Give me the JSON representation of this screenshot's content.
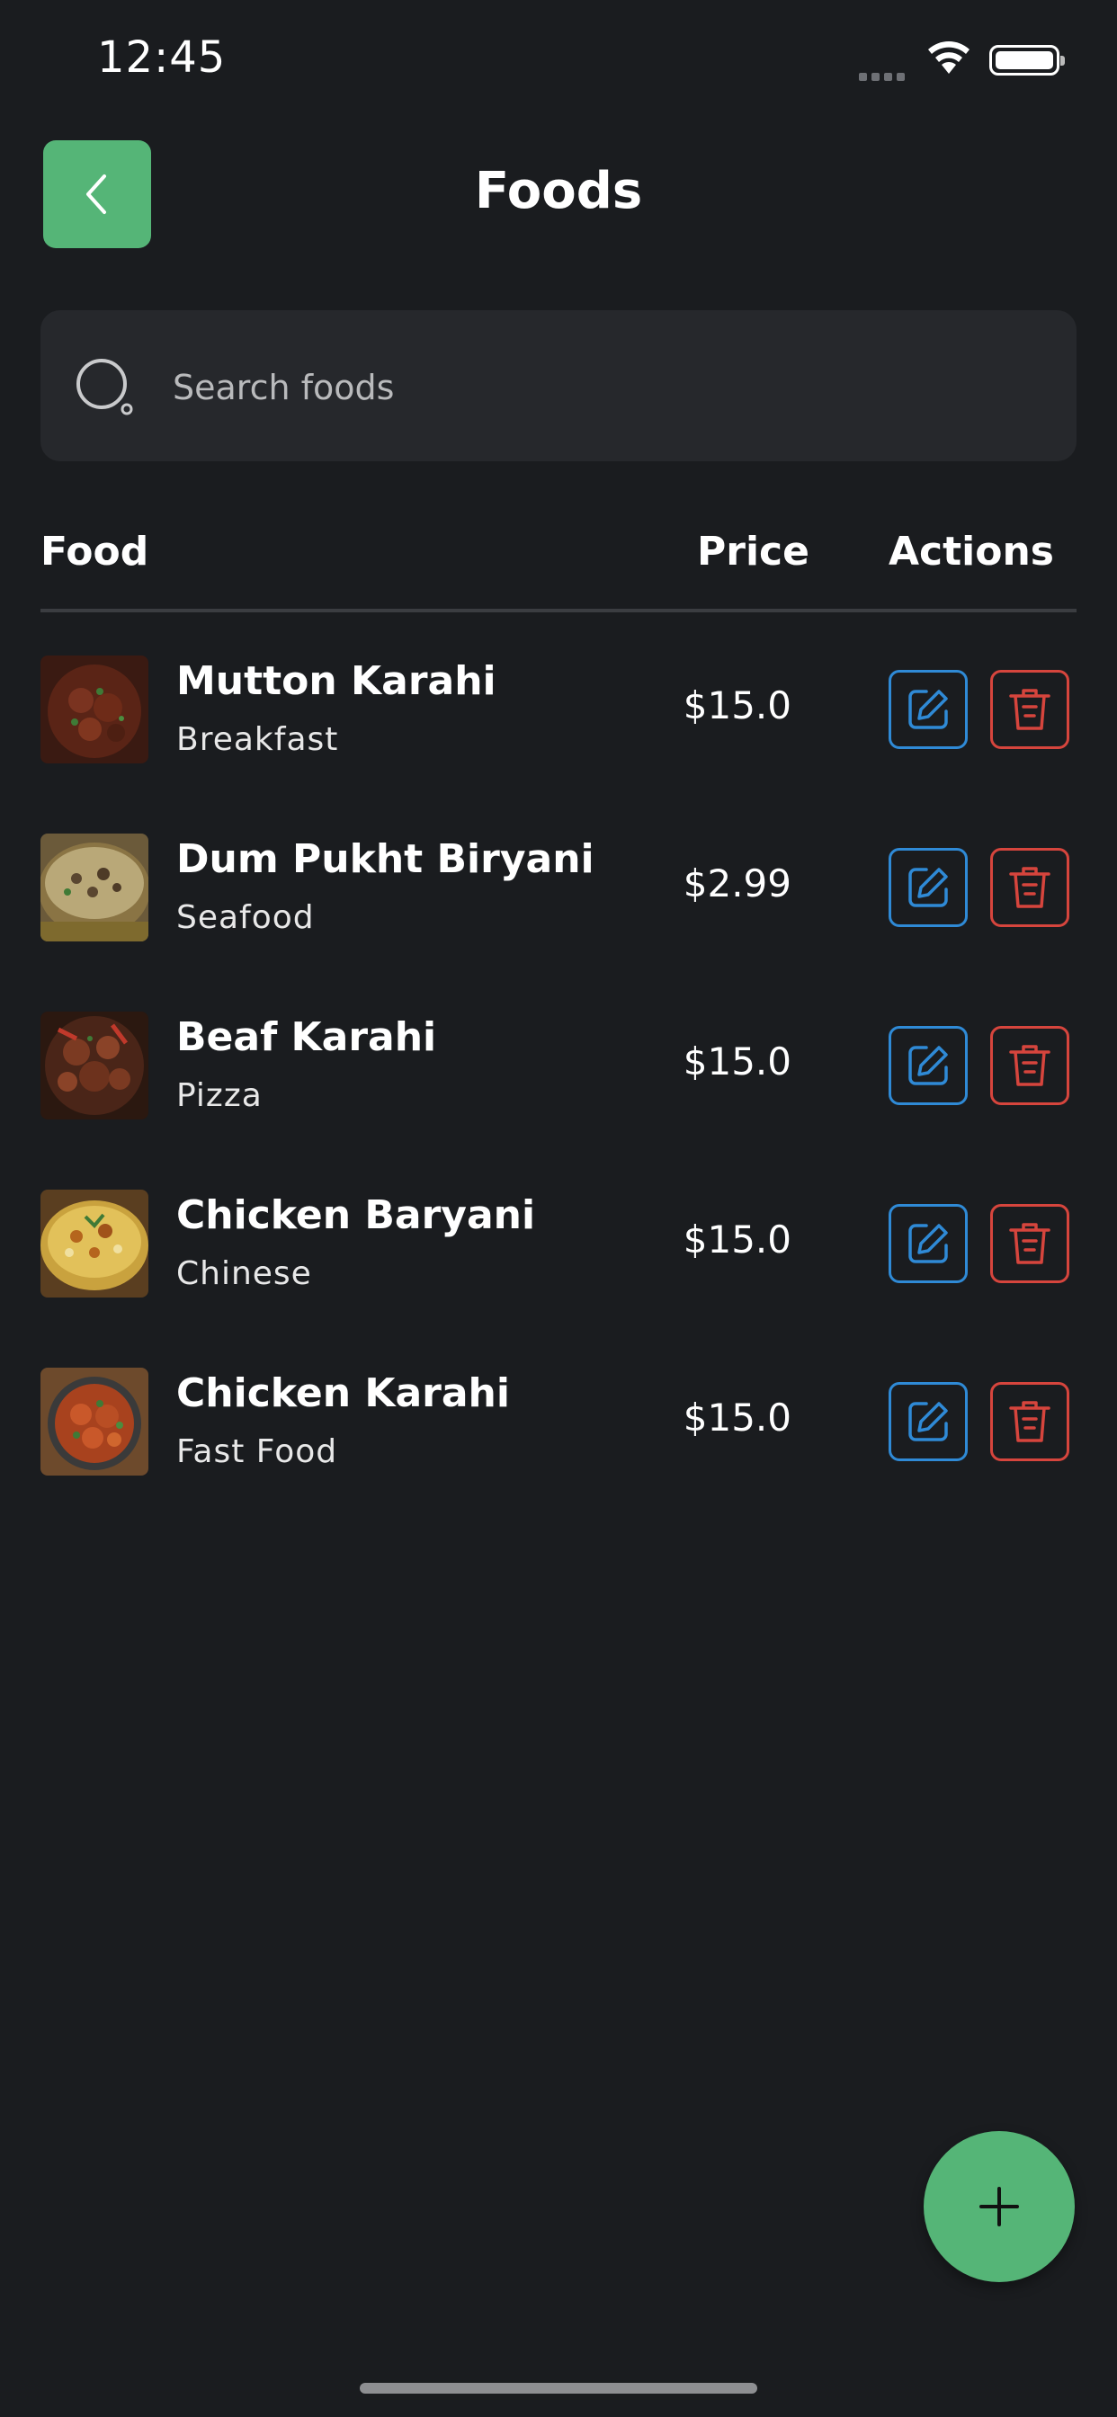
{
  "status_bar": {
    "time": "12:45"
  },
  "header": {
    "title": "Foods",
    "back_icon": "chevron-left-icon"
  },
  "search": {
    "placeholder": "Search foods",
    "value": "",
    "icon": "search-icon"
  },
  "table": {
    "columns": [
      "Food",
      "Price",
      "Actions"
    ],
    "rows": [
      {
        "name": "Mutton Karahi",
        "category": "Breakfast",
        "price": "$15.0"
      },
      {
        "name": "Dum Pukht Biryani",
        "category": "Seafood",
        "price": "$2.99"
      },
      {
        "name": "Beaf Karahi",
        "category": "Pizza",
        "price": "$15.0"
      },
      {
        "name": "Chicken Baryani",
        "category": "Chinese",
        "price": "$15.0"
      },
      {
        "name": "Chicken Karahi",
        "category": "Fast Food",
        "price": "$15.0"
      }
    ]
  },
  "colors": {
    "background": "#1a1c1f",
    "accent_green": "#55b577",
    "edit_blue": "#2f8ad6",
    "delete_red": "#d6453d",
    "search_bg": "#26282c"
  },
  "icons": {
    "edit": "edit-icon",
    "delete": "trash-icon",
    "add": "plus-icon"
  }
}
